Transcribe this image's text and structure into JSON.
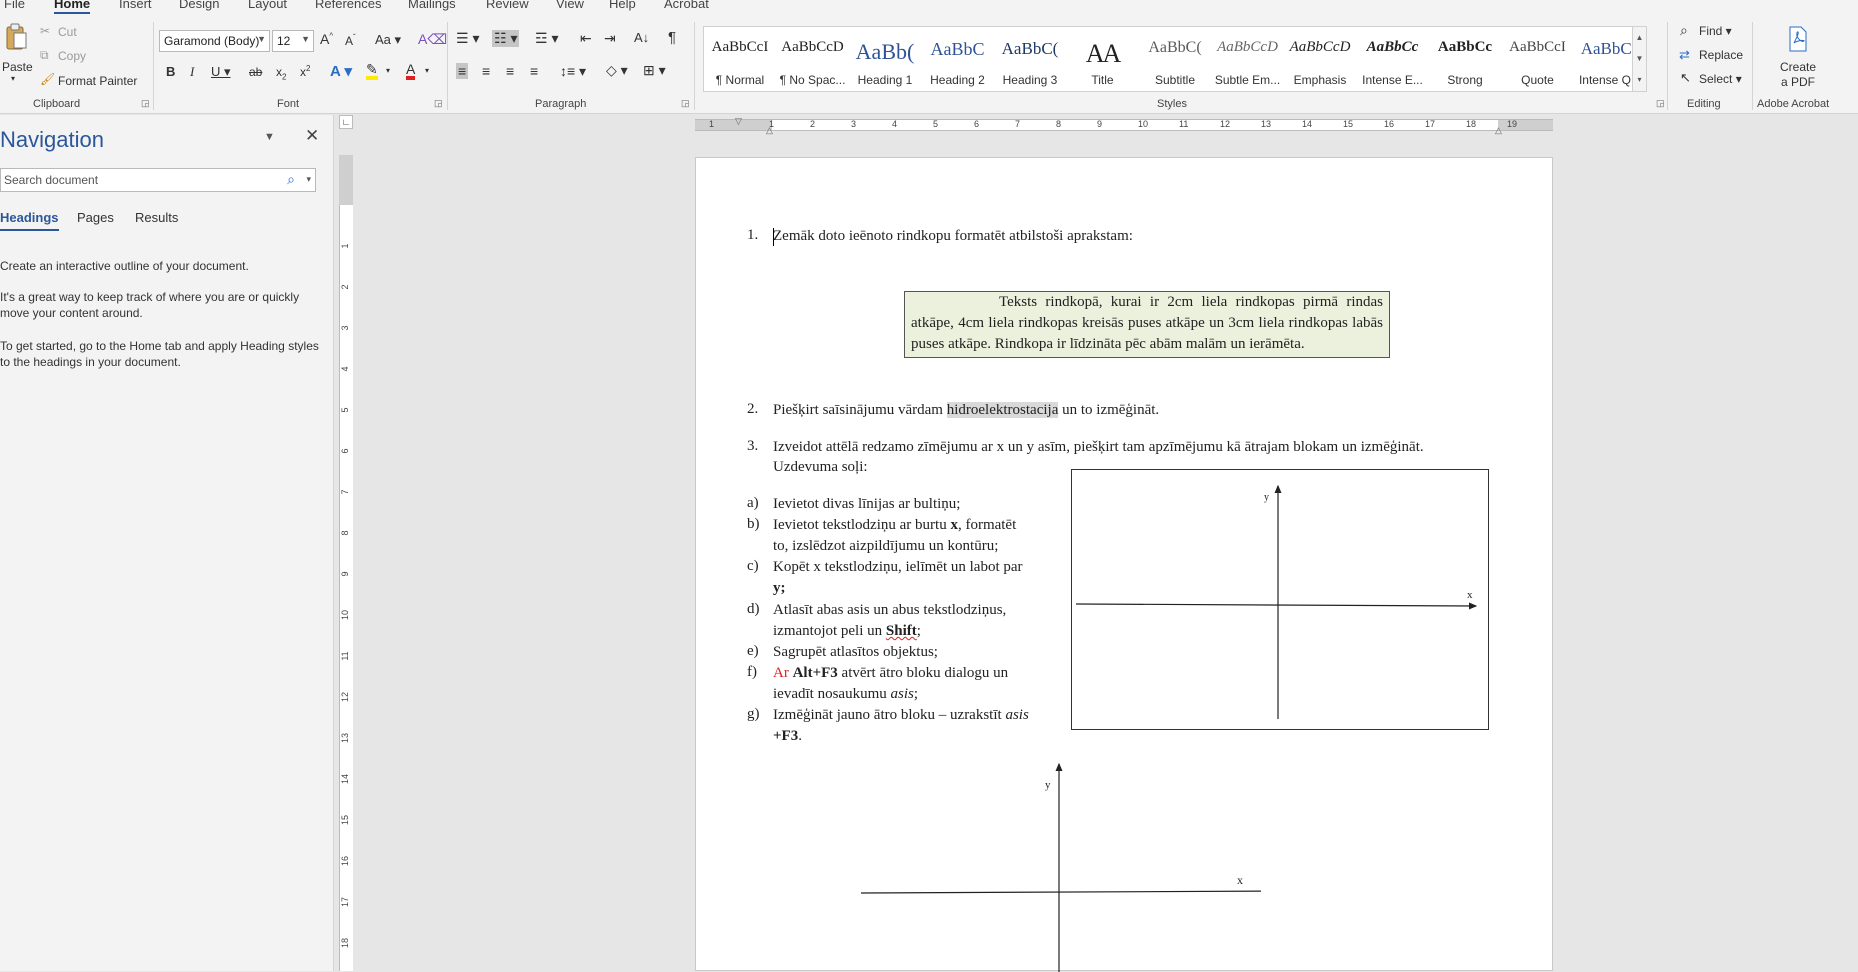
{
  "tabs": [
    "File",
    "Home",
    "Insert",
    "Design",
    "Layout",
    "References",
    "Mailings",
    "Review",
    "View",
    "Help",
    "Acrobat"
  ],
  "clipboard": {
    "paste": "Paste",
    "cut": "Cut",
    "copy": "Copy",
    "format_painter": "Format Painter",
    "label": "Clipboard"
  },
  "font": {
    "name": "Garamond (Body)",
    "size": "12",
    "label": "Font",
    "change_case": "Aa"
  },
  "paragraph": {
    "label": "Paragraph"
  },
  "styles": {
    "label": "Styles",
    "items": [
      {
        "sample": "AaBbCcI",
        "name": "¶ Normal"
      },
      {
        "sample": "AaBbCcD",
        "name": "¶ No Spac..."
      },
      {
        "sample": "AaBb(",
        "name": "Heading 1"
      },
      {
        "sample": "AaBbC",
        "name": "Heading 2"
      },
      {
        "sample": "AaBbC(",
        "name": "Heading 3"
      },
      {
        "sample": "AA",
        "name": "Title"
      },
      {
        "sample": "AaBbC(",
        "name": "Subtitle"
      },
      {
        "sample": "AaBbCcD",
        "name": "Subtle Em..."
      },
      {
        "sample": "AaBbCcD",
        "name": "Emphasis"
      },
      {
        "sample": "AaBbCc",
        "name": "Intense E..."
      },
      {
        "sample": "AaBbCc",
        "name": "Strong"
      },
      {
        "sample": "AaBbCcI",
        "name": "Quote"
      },
      {
        "sample": "AaBbCc",
        "name": "Intense Q..."
      }
    ]
  },
  "editing": {
    "find": "Find",
    "replace": "Replace",
    "select": "Select",
    "label": "Editing"
  },
  "acrobat": {
    "create": "Create",
    "create2": "a PDF",
    "label": "Adobe Acrobat"
  },
  "nav": {
    "title": "Navigation",
    "search_placeholder": "Search document",
    "tabs": [
      "Headings",
      "Pages",
      "Results"
    ],
    "p1": "Create an interactive outline of your document.",
    "p2": "It's a great way to keep track of where you are or quickly move your content around.",
    "p3": "To get started, go to the Home tab and apply Heading styles to the headings in your document."
  },
  "ruler": {
    "h": [
      "1",
      "1",
      "2",
      "3",
      "4",
      "5",
      "6",
      "7",
      "8",
      "9",
      "10",
      "11",
      "12",
      "13",
      "14",
      "15",
      "16",
      "17",
      "18",
      "19"
    ],
    "v": [
      "1",
      "2",
      "3",
      "4",
      "5",
      "6",
      "7",
      "8",
      "9",
      "10",
      "11",
      "12",
      "13",
      "14",
      "15",
      "16",
      "17",
      "18"
    ]
  },
  "doc": {
    "item1_num": "1.",
    "item1": "Zemāk doto ieēnoto rindkopu formatēt atbilstoši aprakstam:",
    "framed": "Teksts rindkopā, kurai ir 2cm liela rindkopas pirmā rindas atkāpe, 4cm liela rindkopas kreisās puses atkāpe un 3cm liela rindkopas labās puses atkāpe. Rindkopa ir līdzināta pēc abām malām un ierāmēta.",
    "item2_num": "2.",
    "item2_a": "Piešķirt saīsinājumu vārdam ",
    "item2_hl": "hidroelektrostacija",
    "item2_b": " un to izmēģināt.",
    "item3_num": "3.",
    "item3_l1": "Izveidot attēlā redzamo zīmējumu ar x un y asīm, piešķirt tam apzīmējumu kā ātrajam blokam un izmēģināt.",
    "item3_l2": "Uzdevuma soļi:",
    "steps": [
      {
        "m": "a)",
        "l1": "Ievietot divas līnijas ar bultiņu;"
      },
      {
        "m": "b)",
        "l1a": "Ievietot tekstlodziņu ar burtu ",
        "l1b": "x",
        "l1c": ", formatēt",
        "l2": "to, izslēdzot aizpildījumu un kontūru;"
      },
      {
        "m": "c)",
        "l1": "Kopēt x tekstlodziņu, ielīmēt un labot par",
        "l2": "y;"
      },
      {
        "m": "d)",
        "l1": "Atlasīt abas asis un abus tekstlodziņus,",
        "l2a": "izmantojot peli un ",
        "l2b": "Shift",
        "l2c": ";"
      },
      {
        "m": "e)",
        "l1": "Sagrupēt atlasītos objektus;"
      },
      {
        "m": "f)",
        "l1a": "Ar ",
        "l1b": "Alt+F3",
        "l1c": " atvērt ātro bloku dialogu un",
        "l2a": "ievadīt nosaukumu ",
        "l2b": "asis",
        "l2c": ";"
      },
      {
        "m": "g)",
        "l1a": "Izmēģināt jauno ātro bloku – uzrakstīt ",
        "l1b": "asis",
        "l2": "+F3",
        "l2c": "."
      }
    ],
    "axis_x": "x",
    "axis_y": "y"
  }
}
